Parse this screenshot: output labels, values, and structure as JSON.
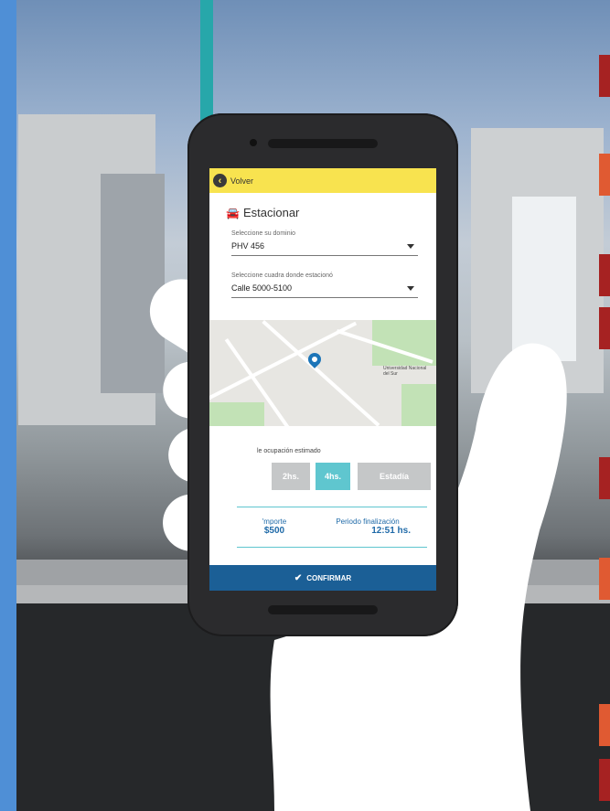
{
  "topbar": {
    "back_label": "Volver",
    "back_icon": "chevron-left-icon",
    "color": "#f8e34f"
  },
  "page": {
    "title": "Estacionar",
    "title_icon": "car-icon"
  },
  "dominio": {
    "label": "Seleccione su dominio",
    "value": "PHV  456"
  },
  "cuadra": {
    "label": "Seleccione cuadra donde estacionó",
    "value": "Calle 5000-5100"
  },
  "map": {
    "place_label": "Universidad Nacional del Sur"
  },
  "ocupacion": {
    "label": "le ocupación estimado",
    "options": [
      "2hs.",
      "4hs.",
      "Estadía"
    ],
    "selected": "4hs.",
    "accent": "#5fc6cf"
  },
  "summary": {
    "importe_label": "'mporte",
    "importe_value": "$500",
    "periodo_label": "Periodo finalización",
    "periodo_value": "12:51 hs."
  },
  "confirm": {
    "label": "CONFIRMAR",
    "icon": "check-icon",
    "color": "#1b5f96"
  }
}
